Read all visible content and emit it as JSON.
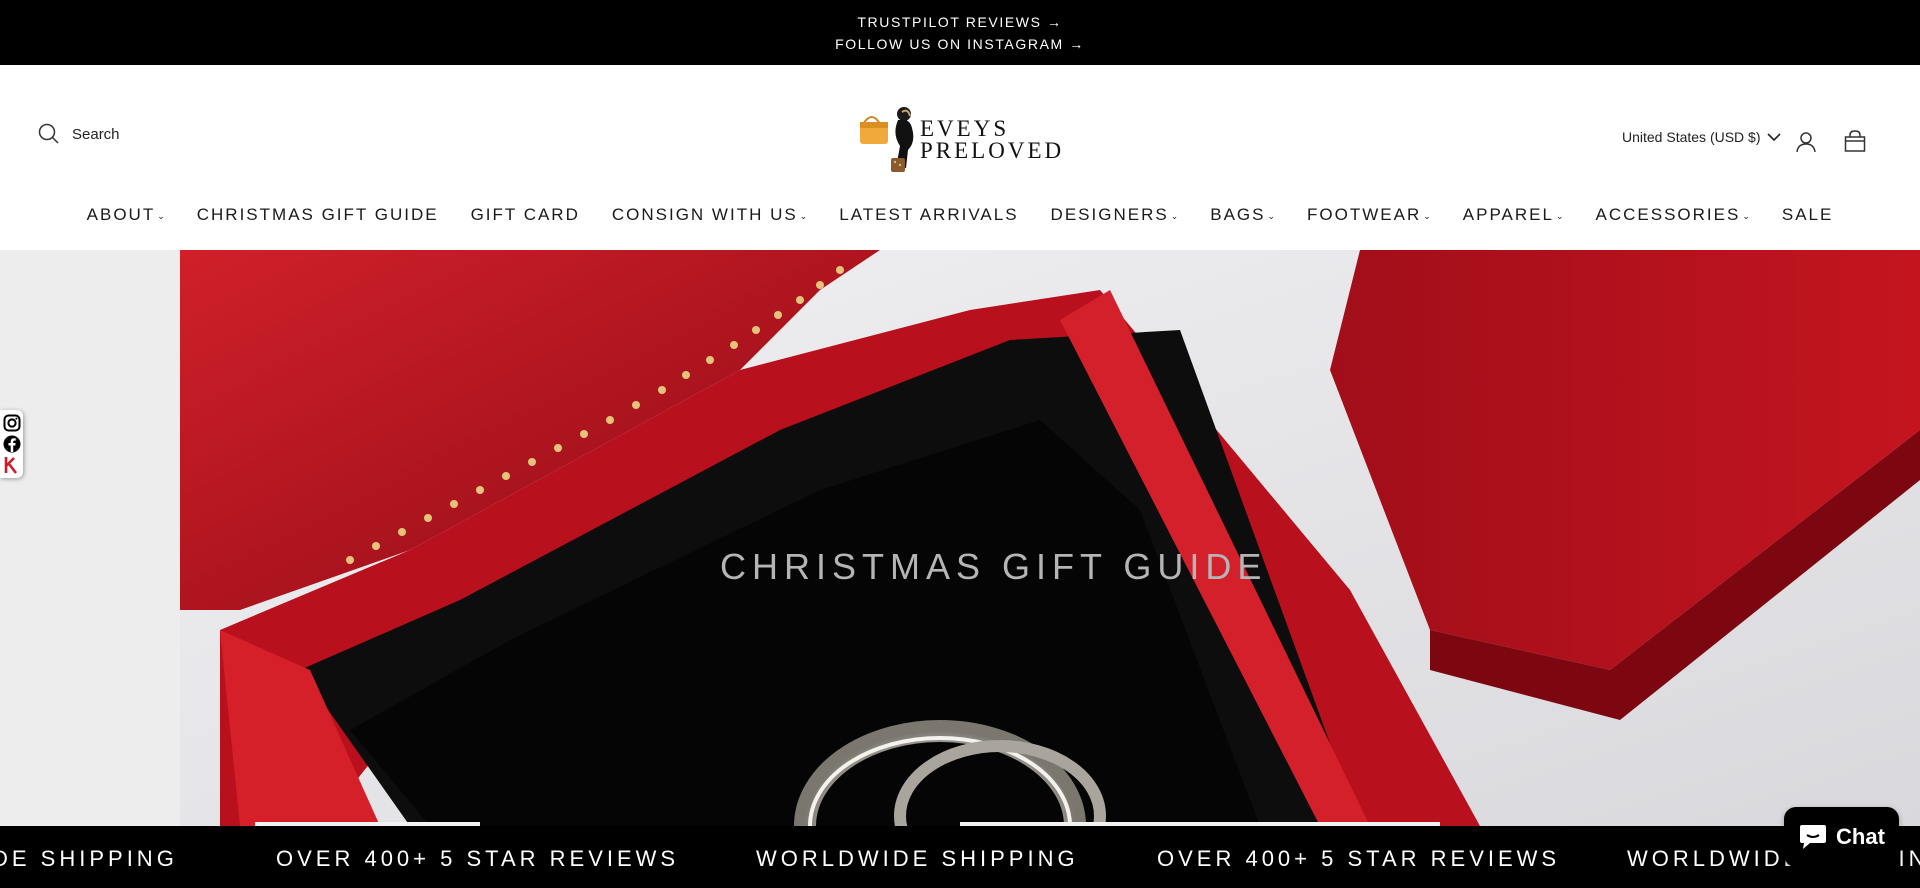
{
  "announcement": {
    "line1": "TRUSTPILOT REVIEWS →",
    "line2": "FOLLOW US ON INSTAGRAM →"
  },
  "header": {
    "search_label": "Search",
    "logo_text_line1": "EVEYS",
    "logo_text_line2": "PRELOVED",
    "currency": "United States (USD $)"
  },
  "nav": {
    "items": [
      {
        "label": "ABOUT",
        "has_dropdown": true
      },
      {
        "label": "CHRISTMAS GIFT GUIDE",
        "has_dropdown": false
      },
      {
        "label": "GIFT CARD",
        "has_dropdown": false
      },
      {
        "label": "CONSIGN WITH US",
        "has_dropdown": true
      },
      {
        "label": "LATEST ARRIVALS",
        "has_dropdown": false
      },
      {
        "label": "DESIGNERS",
        "has_dropdown": true
      },
      {
        "label": "BAGS",
        "has_dropdown": true
      },
      {
        "label": "FOOTWEAR",
        "has_dropdown": true
      },
      {
        "label": "APPAREL",
        "has_dropdown": true
      },
      {
        "label": "ACCESSORIES",
        "has_dropdown": true
      },
      {
        "label": "SALE",
        "has_dropdown": false
      }
    ]
  },
  "hero": {
    "title": "CHRISTMAS GIFT GUIDE"
  },
  "marquee": {
    "items": [
      "DE SHIPPING",
      "OVER 400+ 5 STAR REVIEWS",
      "WORLDWIDE SHIPPING",
      "OVER 400+ 5 STAR REVIEWS",
      "WORLDWIDE SHIPPING"
    ]
  },
  "chat": {
    "label": "Chat"
  },
  "social": [
    "instagram-icon",
    "facebook-icon",
    "klarna-icon"
  ],
  "colors": {
    "announcement_bg": "#000000",
    "box_red": "#b4101c",
    "velvet": "#0c0c0c",
    "chat_bg": "#000000"
  }
}
